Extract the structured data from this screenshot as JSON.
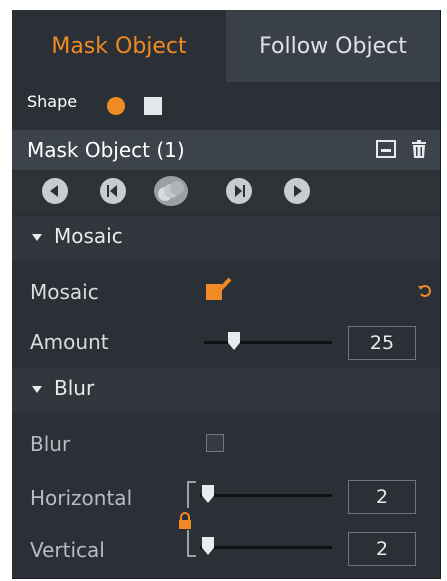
{
  "tabs": [
    {
      "label": "Mask Object",
      "active": true
    },
    {
      "label": "Follow Object",
      "active": false
    }
  ],
  "shape": {
    "label": "Shape",
    "options": [
      "circle-icon",
      "square-icon"
    ],
    "selected": "circle"
  },
  "object": {
    "title": "Mask Object (1)"
  },
  "nav": [
    "prev-icon",
    "prev-frame-icon",
    "track-icon",
    "next-frame-icon",
    "next-icon"
  ],
  "mosaic_section": {
    "label": "Mosaic"
  },
  "mosaic": {
    "label": "Mosaic",
    "checked": true
  },
  "amount": {
    "label": "Amount",
    "value": "25",
    "fraction": 0.25
  },
  "blur_section": {
    "label": "Blur"
  },
  "blur": {
    "label": "Blur",
    "checked": false
  },
  "horizontal": {
    "label": "Horizontal",
    "value": "2"
  },
  "vertical": {
    "label": "Vertical",
    "value": "2"
  },
  "colors": {
    "accent": "#f08a24",
    "panel": "#2b3036",
    "text": "#e8ebee"
  }
}
